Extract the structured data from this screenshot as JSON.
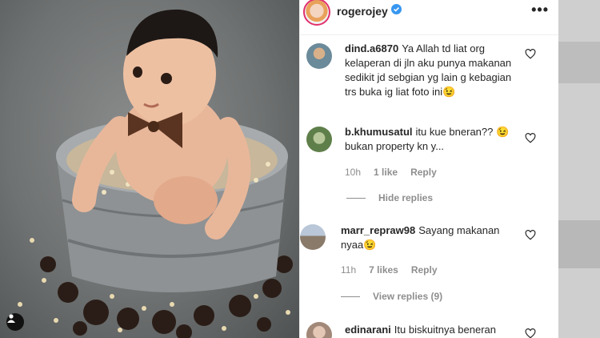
{
  "post": {
    "username": "rogerojey",
    "more_label": "•••"
  },
  "comments": [
    {
      "username": "dind.a6870",
      "text": "Ya Allah td liat org kelaperan di jln aku punya makanan sedikit jd sebgian yg lain g kebagian trs buka ig liat foto ini😉"
    },
    {
      "username": "b.khumusatul",
      "text": "itu kue bneran?? 😉 bukan property kn y...",
      "time": "10h",
      "likes": "1 like",
      "reply": "Reply",
      "replies_toggle": "Hide replies"
    },
    {
      "username": "marr_repraw98",
      "text": "Sayang makanan nyaa😉",
      "time": "11h",
      "likes": "7 likes",
      "reply": "Reply",
      "replies_toggle": "View replies (9)"
    },
    {
      "username": "edinarani",
      "text": "Itu biskuitnya beneran"
    }
  ],
  "colors": {
    "verified": "#3897f0",
    "secondary_text": "#8e8e8e"
  }
}
